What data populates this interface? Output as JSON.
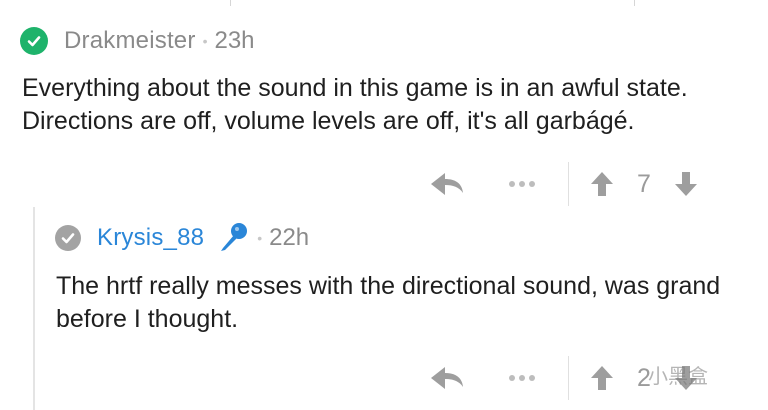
{
  "comments": [
    {
      "author": "Drakmeister",
      "separator": "•",
      "time": "23h",
      "text": "Everything about the sound in this game is in an awful state. Directions are off, volume levels are off, it's all garbágé.",
      "more": "•••",
      "score": "7",
      "author_color": "#8a8a8a",
      "badge_color": "#1eb36b"
    },
    {
      "author": "Krysis_88",
      "separator": "•",
      "time": "22h",
      "text": "The hrtf really messes with the directional sound, was grand before I thought.",
      "more": "•••",
      "score": "2",
      "author_color": "#2a86d8",
      "badge_color": "#a3a3a3"
    }
  ],
  "watermark": "小黑盒"
}
